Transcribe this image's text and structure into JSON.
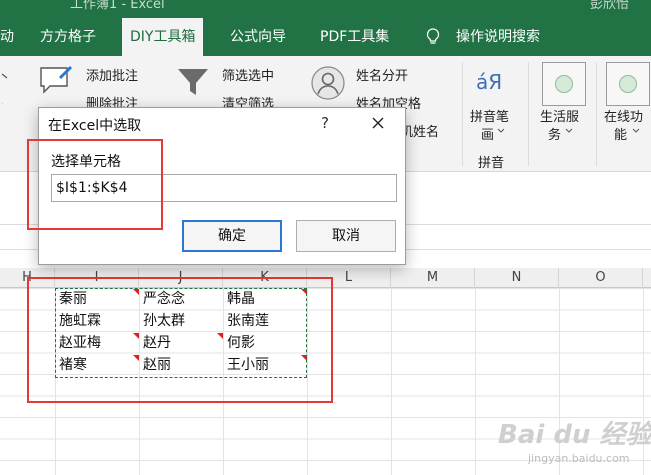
{
  "window": {
    "title": "工作簿1 - Excel",
    "user": "彭欣怡"
  },
  "ribbon_tabs": [
    "动",
    "方方格子",
    "DIY工具箱",
    "公式向导",
    "PDF工具集",
    "操作说明搜索"
  ],
  "active_tab": "DIY工具箱",
  "ribbon": {
    "add_comment": "添加批注",
    "delete_comment": "删除批注",
    "filter_selected": "筛选选中",
    "clear_filter": "清空筛选",
    "split_name": "姓名分开",
    "name_add_space": "姓名加空格",
    "random_name": "机姓名",
    "pinyin_pen_line1": "拼音笔",
    "pinyin_pen_line2": "画",
    "pinyin_group": "拼音",
    "life_service_line1": "生活服",
    "life_service_line2": "务",
    "online_func_line1": "在线功",
    "online_func_line2": "能",
    "pinyin_icon_text": "áЯ"
  },
  "dialog": {
    "title": "在Excel中选取",
    "help": "?",
    "label": "选择单元格",
    "value": "$I$1:$K$4",
    "ok": "确定",
    "cancel": "取消"
  },
  "columns": [
    "H",
    "I",
    "J",
    "K",
    "L",
    "M",
    "N",
    "O"
  ],
  "cells": [
    [
      "秦丽",
      "严念念",
      "韩晶"
    ],
    [
      "施虹霖",
      "孙太群",
      "张南莲"
    ],
    [
      "赵亚梅",
      "赵丹",
      "何影"
    ],
    [
      "褚寒",
      "赵丽",
      "王小丽"
    ]
  ],
  "watermark": {
    "line1": "Bai du 经验",
    "line2": "jingyan.baidu.com"
  },
  "colors": {
    "excel_green": "#217346",
    "highlight_red": "#e53935",
    "comment_red": "#e0201e"
  }
}
